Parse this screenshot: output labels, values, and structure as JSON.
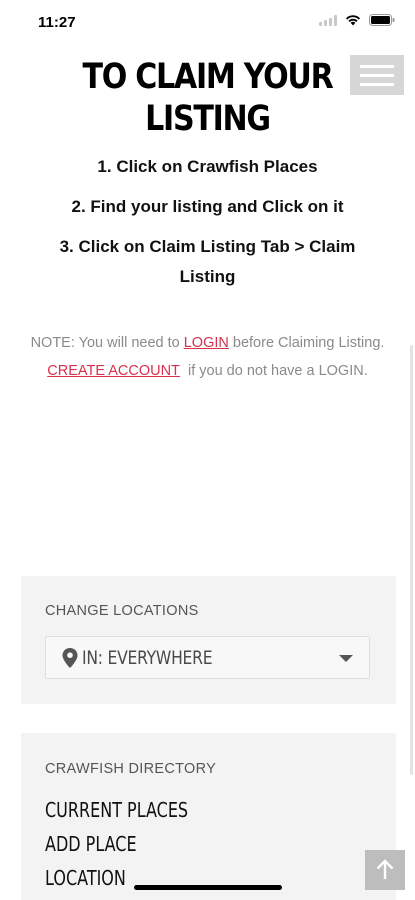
{
  "status_bar": {
    "time": "11:27",
    "icons": [
      "signal-icon",
      "wifi-icon",
      "battery-icon"
    ]
  },
  "header": {
    "menu_icon": "hamburger-menu-icon",
    "title_line1": "TO CLAIM YOUR",
    "title_line2": "LISTING"
  },
  "steps": [
    "1. Click on Crawfish Places",
    "2. Find your listing and Click on it",
    "3. Click on Claim Listing Tab > Claim Listing"
  ],
  "note": {
    "prefix": "NOTE: You will need to",
    "login_link": "LOGIN",
    "middle": "before Claiming Listing.",
    "create_account_link": "CREATE ACCOUNT",
    "suffix": "if you do not have a LOGIN."
  },
  "change_locations": {
    "title": "CHANGE LOCATIONS",
    "selected": "IN: EVERYWHERE"
  },
  "directory": {
    "title": "CRAWFISH DIRECTORY",
    "items": [
      "CURRENT PLACES",
      "ADD PLACE",
      "LOCATION"
    ]
  },
  "colors": {
    "link": "#d6324b",
    "note_text": "#8a8a8a",
    "widget_bg": "#f3f3f3",
    "menu_button_bg": "#d6d6d6",
    "back_to_top_bg": "#bdbdbd"
  }
}
